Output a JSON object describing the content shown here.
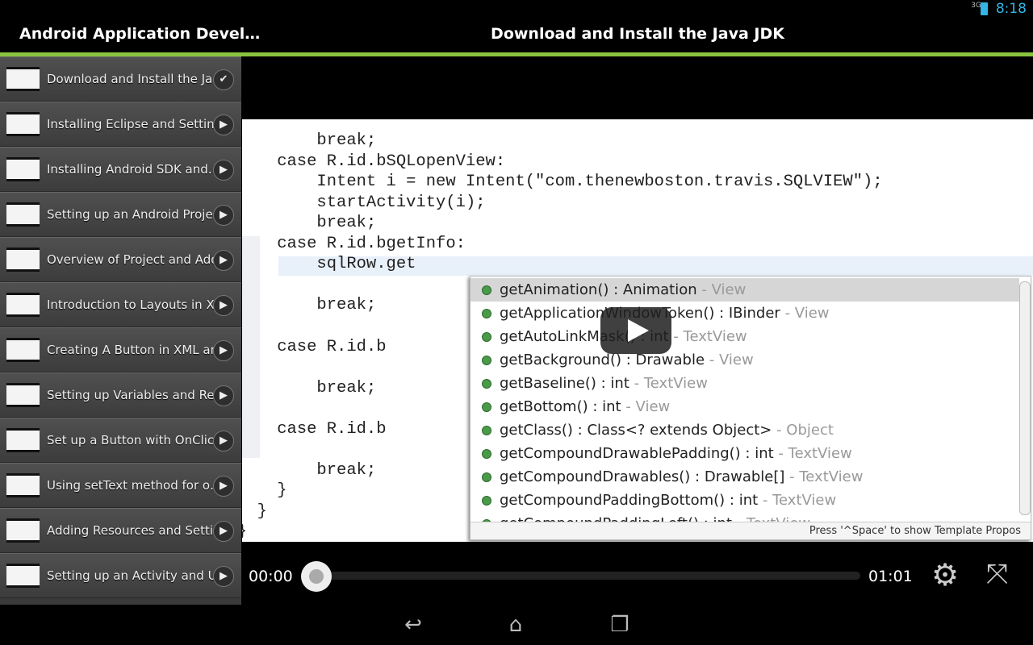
{
  "status_bar": {
    "network": "3G",
    "time": "8:18",
    "battery_color": "#33b5e5"
  },
  "action_bar": {
    "app_title": "Android Application Devel…",
    "video_title": "Download and Install the Java JDK",
    "accent_color": "#8ac43f"
  },
  "playlist": [
    {
      "label": "Download and Install the Ja…",
      "state": "watched",
      "icon": "check-icon"
    },
    {
      "label": "Installing Eclipse and Settin…",
      "state": "play",
      "icon": "play-icon"
    },
    {
      "label": "Installing Android SDK and…",
      "state": "play",
      "icon": "play-icon"
    },
    {
      "label": "Setting up an Android Project",
      "state": "play",
      "icon": "play-icon"
    },
    {
      "label": "Overview of Project and Add…",
      "state": "play",
      "icon": "play-icon"
    },
    {
      "label": "Introduction to Layouts in X…",
      "state": "play",
      "icon": "play-icon"
    },
    {
      "label": "Creating A Button in XML an…",
      "state": "play",
      "icon": "play-icon"
    },
    {
      "label": "Setting up Variables and Ref…",
      "state": "play",
      "icon": "play-icon"
    },
    {
      "label": "Set up a Button with OnClic…",
      "state": "play",
      "icon": "play-icon"
    },
    {
      "label": "Using setText method for o…",
      "state": "play",
      "icon": "play-icon"
    },
    {
      "label": "Adding Resources and Setti…",
      "state": "play",
      "icon": "play-icon"
    },
    {
      "label": "Setting up an Activity and U…",
      "state": "play",
      "icon": "play-icon"
    }
  ],
  "video_frame": {
    "code": [
      "        break;",
      "    case R.id.bSQLopenView:",
      "        Intent i = new Intent(\"com.thenewboston.travis.SQLVIEW\");",
      "        startActivity(i);",
      "        break;",
      "    case R.id.bgetInfo:",
      "        sqlRow.get",
      "",
      "        break;",
      "",
      "    case R.id.b",
      "",
      "        break;",
      "",
      "    case R.id.b",
      "",
      "        break;",
      "    }",
      "  }",
      "}"
    ],
    "suggestions": [
      {
        "sig": "getAnimation() : Animation",
        "cls": " - View"
      },
      {
        "sig": "getApplicationWindowToken() : IBinder",
        "cls": " - View"
      },
      {
        "sig": "getAutoLinkMask() : int",
        "cls": " - TextView"
      },
      {
        "sig": "getBackground() : Drawable",
        "cls": " - View"
      },
      {
        "sig": "getBaseline() : int",
        "cls": " - TextView"
      },
      {
        "sig": "getBottom() : int",
        "cls": " - View"
      },
      {
        "sig": "getClass() : Class<? extends Object>",
        "cls": " - Object"
      },
      {
        "sig": "getCompoundDrawablePadding() : int",
        "cls": " - TextView"
      },
      {
        "sig": "getCompoundDrawables() : Drawable[]",
        "cls": " - TextView"
      },
      {
        "sig": "getCompoundPaddingBottom() : int",
        "cls": " - TextView"
      },
      {
        "sig": "getCompoundPaddingLeft() : int",
        "cls": " - TextView"
      }
    ],
    "popup_footer": "Press '^Space' to show Template Propos"
  },
  "player": {
    "current_time": "00:00",
    "duration": "01:01",
    "progress_percent": 0
  },
  "nav": {
    "back": "back-icon",
    "home": "home-icon",
    "recents": "recents-icon"
  }
}
